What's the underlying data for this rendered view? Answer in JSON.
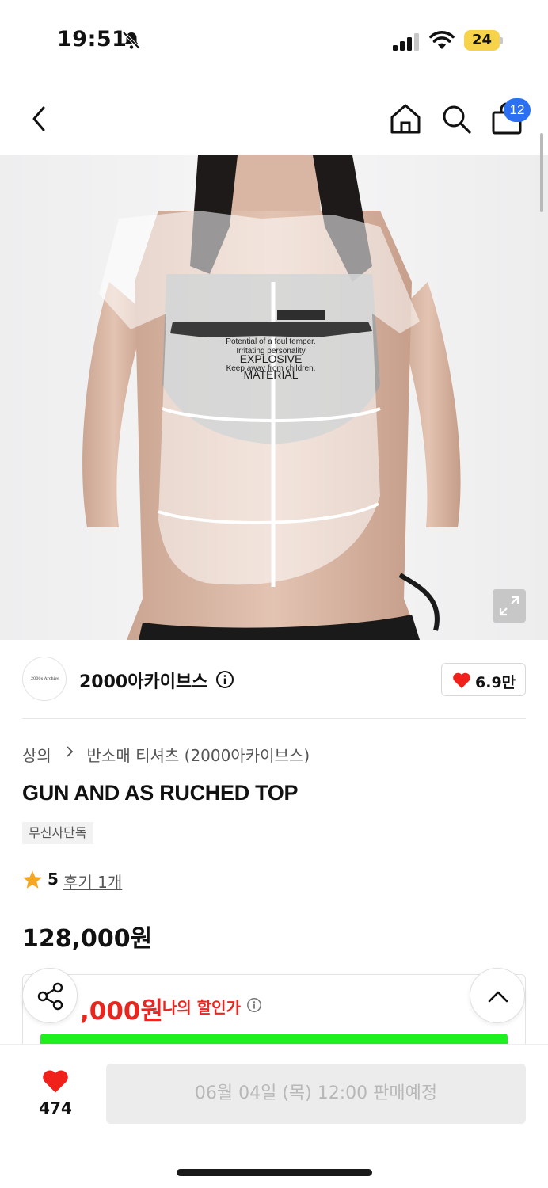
{
  "status_bar": {
    "time": "19:51",
    "battery": "24",
    "battery_color": "#f6d34a"
  },
  "nav": {
    "back_icon": "chevron-left-icon",
    "home_icon": "home-icon",
    "search_icon": "search-icon",
    "cart_icon": "shopping-bag-icon",
    "cart_count": "12",
    "badge_color": "#2b6ff2"
  },
  "image": {
    "print_line_1": "Potential of a foul temper.",
    "print_line_2": "Irritating personality",
    "print_line_3": "Keep away from children.",
    "print_headline_1": "EXPLOSIVE",
    "print_headline_2": "MATERIAL",
    "expand_icon": "expand-icon"
  },
  "brand": {
    "logo_text": "2000s Archive",
    "name": "2000아카이브스",
    "like_count": "6.9만",
    "heart_color": "#f0201b"
  },
  "product": {
    "breadcrumb": [
      "상의",
      "반소매 티셔츠 (2000아카이브스)"
    ],
    "title": "GUN AND AS RUCHED TOP",
    "badge": "무신사단독",
    "rating": "5",
    "review_link": "후기 1개",
    "price": "128,000원",
    "star_color": "#f5a623"
  },
  "discount": {
    "price": ",000원",
    "label": "나의 할인가",
    "accent_color": "#e8251e",
    "banner_color": "#1ef01e"
  },
  "bottom": {
    "like_count": "474",
    "sale_button": "06월 04일 (목) 12:00 판매예정"
  }
}
